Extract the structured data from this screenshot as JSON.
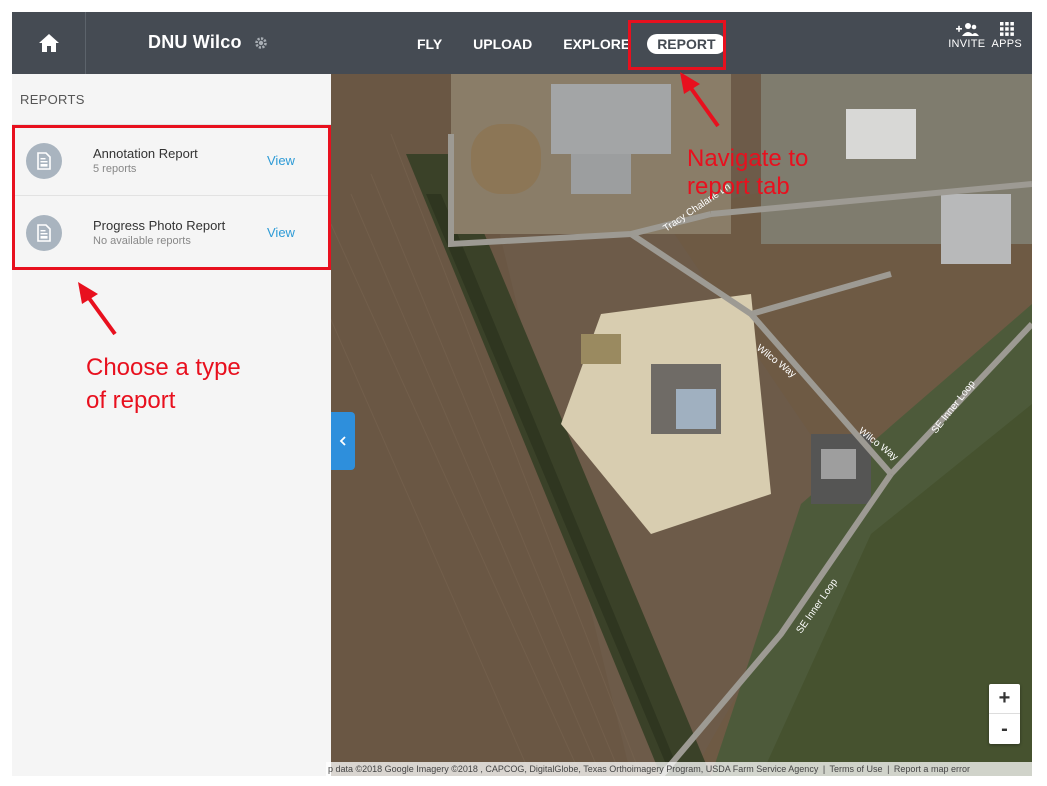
{
  "header": {
    "project_name": "DNU Wilco",
    "nav": [
      "FLY",
      "UPLOAD",
      "EXPLORE",
      "REPORT"
    ],
    "active_tab": "REPORT",
    "invite_label": "INVITE",
    "apps_label": "APPS"
  },
  "sidebar": {
    "title": "REPORTS",
    "reports": [
      {
        "name": "Annotation Report",
        "sub": "5 reports",
        "action": "View"
      },
      {
        "name": "Progress Photo Report",
        "sub": "No available reports",
        "action": "View"
      }
    ]
  },
  "map": {
    "roads": [
      "Tracy Chalane Ln",
      "Wilco Way",
      "Wilco Way",
      "SE Inner Loop",
      "SE Inner Loop"
    ],
    "zoom_in": "+",
    "zoom_out": "-",
    "attribution": "p data ©2018 Google Imagery ©2018 , CAPCOG, DigitalGlobe, Texas Orthoimagery Program, USDA Farm Service Agency",
    "terms": "Terms of Use",
    "report_error": "Report a map error"
  },
  "annotations": {
    "nav_hint": "Navigate to report tab",
    "report_hint_line1": "Choose a type",
    "report_hint_line2": "of report",
    "color": "#e8101e"
  }
}
